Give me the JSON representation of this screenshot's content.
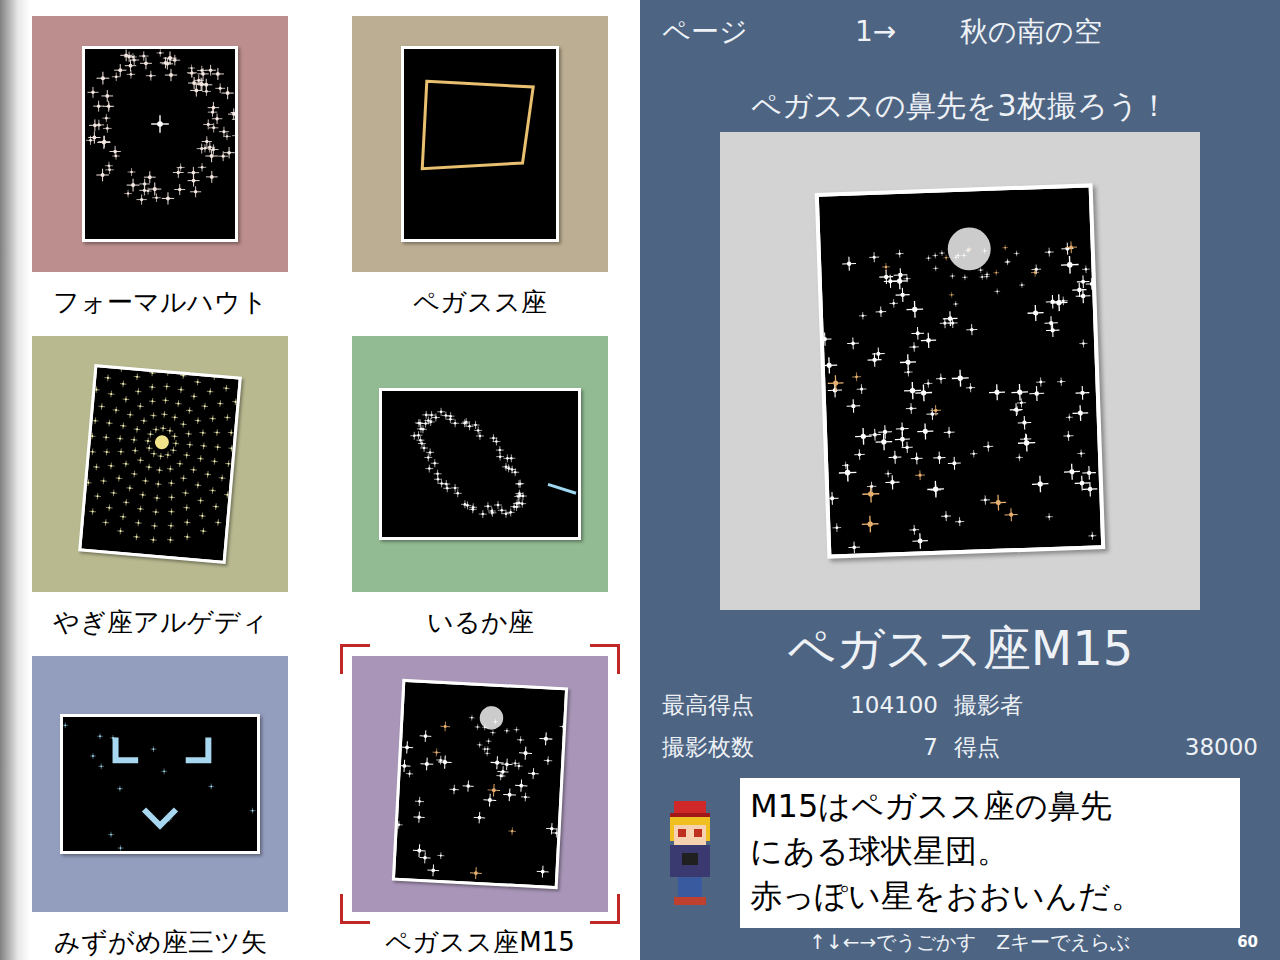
{
  "album": {
    "cards": [
      {
        "label": "フォーマルハウト",
        "color": "#bc8e8e",
        "kind": "ring",
        "selected": false
      },
      {
        "label": "ペガスス座",
        "color": "#bcae92",
        "kind": "square",
        "selected": false
      },
      {
        "label": "やぎ座アルゲディ",
        "color": "#b8b98f",
        "kind": "radial",
        "selected": false
      },
      {
        "label": "いるか座",
        "color": "#93bb93",
        "kind": "ellipse",
        "selected": false
      },
      {
        "label": "みずがめ座三ツ矢",
        "color": "#939dbe",
        "kind": "arrows",
        "selected": false
      },
      {
        "label": "ペガスス座M15",
        "color": "#a895b8",
        "kind": "cluster",
        "selected": true
      }
    ]
  },
  "header": {
    "page_label": "ページ",
    "page_number": "1→",
    "area": "秋の南の空"
  },
  "mission": "ペガススの鼻先を3枚撮ろう！",
  "detail": {
    "title": "ペガスス座M15",
    "kind": "cluster",
    "stats": [
      {
        "label": "最高得点",
        "value": "104100",
        "label2": "撮影者"
      },
      {
        "label": "撮影枚数",
        "value": "7",
        "label2": "得点",
        "value2": "38000"
      }
    ],
    "description": [
      "M15はペガスス座の鼻先",
      "にある球状星団。",
      "赤っぽい星をおおいんだ。"
    ]
  },
  "footer": {
    "hint": "↑↓←→でうごかす　Zキーでえらぶ",
    "fps": "60"
  }
}
